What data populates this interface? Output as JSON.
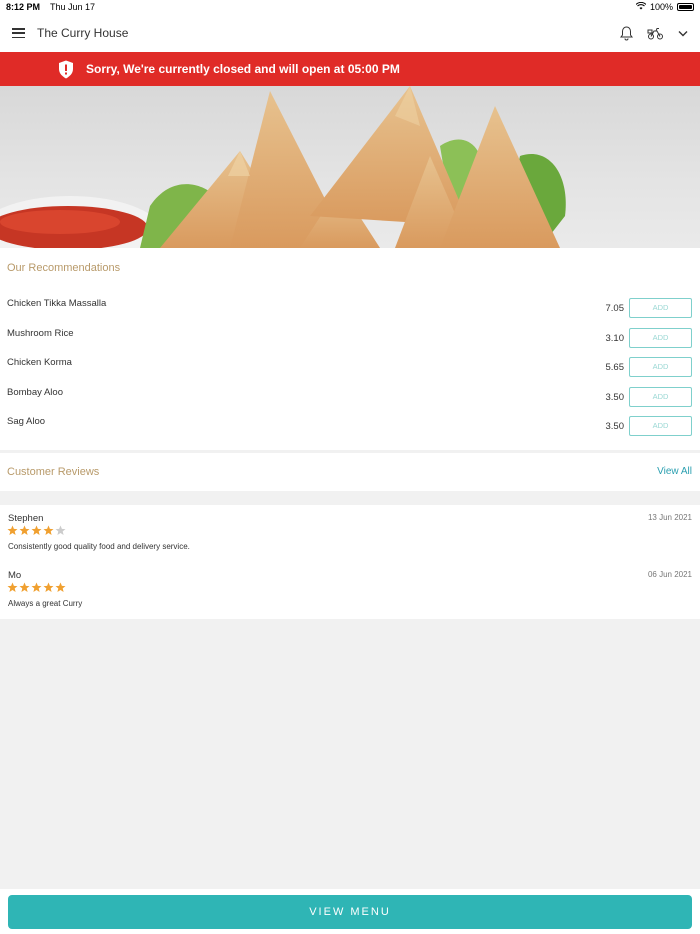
{
  "status_bar": {
    "time": "8:12 PM",
    "date": "Thu Jun 17",
    "battery": "100%"
  },
  "header": {
    "title": "The Curry House",
    "icons": [
      "menu-icon",
      "bell-icon",
      "delivery-scooter-icon",
      "chevron-down-icon"
    ]
  },
  "banner": {
    "message": "Sorry, We're currently closed and will open at 05:00 PM",
    "color": "#e02b27"
  },
  "recommendations": {
    "title": "Our Recommendations",
    "add_label": "ADD",
    "items": [
      {
        "name": "Chicken Tikka Massalla",
        "price": "7.05"
      },
      {
        "name": "Mushroom Rice",
        "price": "3.10"
      },
      {
        "name": "Chicken Korma",
        "price": "5.65"
      },
      {
        "name": "Bombay Aloo",
        "price": "3.50"
      },
      {
        "name": "Sag Aloo",
        "price": "3.50"
      }
    ]
  },
  "reviews": {
    "title": "Customer Reviews",
    "view_all_label": "View All",
    "items": [
      {
        "author": "Stephen",
        "date": "13 Jun 2021",
        "rating": 4,
        "comment": "Consistently good quality food and delivery service."
      },
      {
        "author": "Mo",
        "date": "06 Jun 2021",
        "rating": 5,
        "comment": "Always a great Curry"
      }
    ]
  },
  "footer": {
    "view_menu_label": "VIEW MENU"
  },
  "colors": {
    "accent": "#2fb5b5",
    "section_title": "#b89a6a",
    "star": "#f0a030",
    "star_empty": "#cccccc"
  }
}
